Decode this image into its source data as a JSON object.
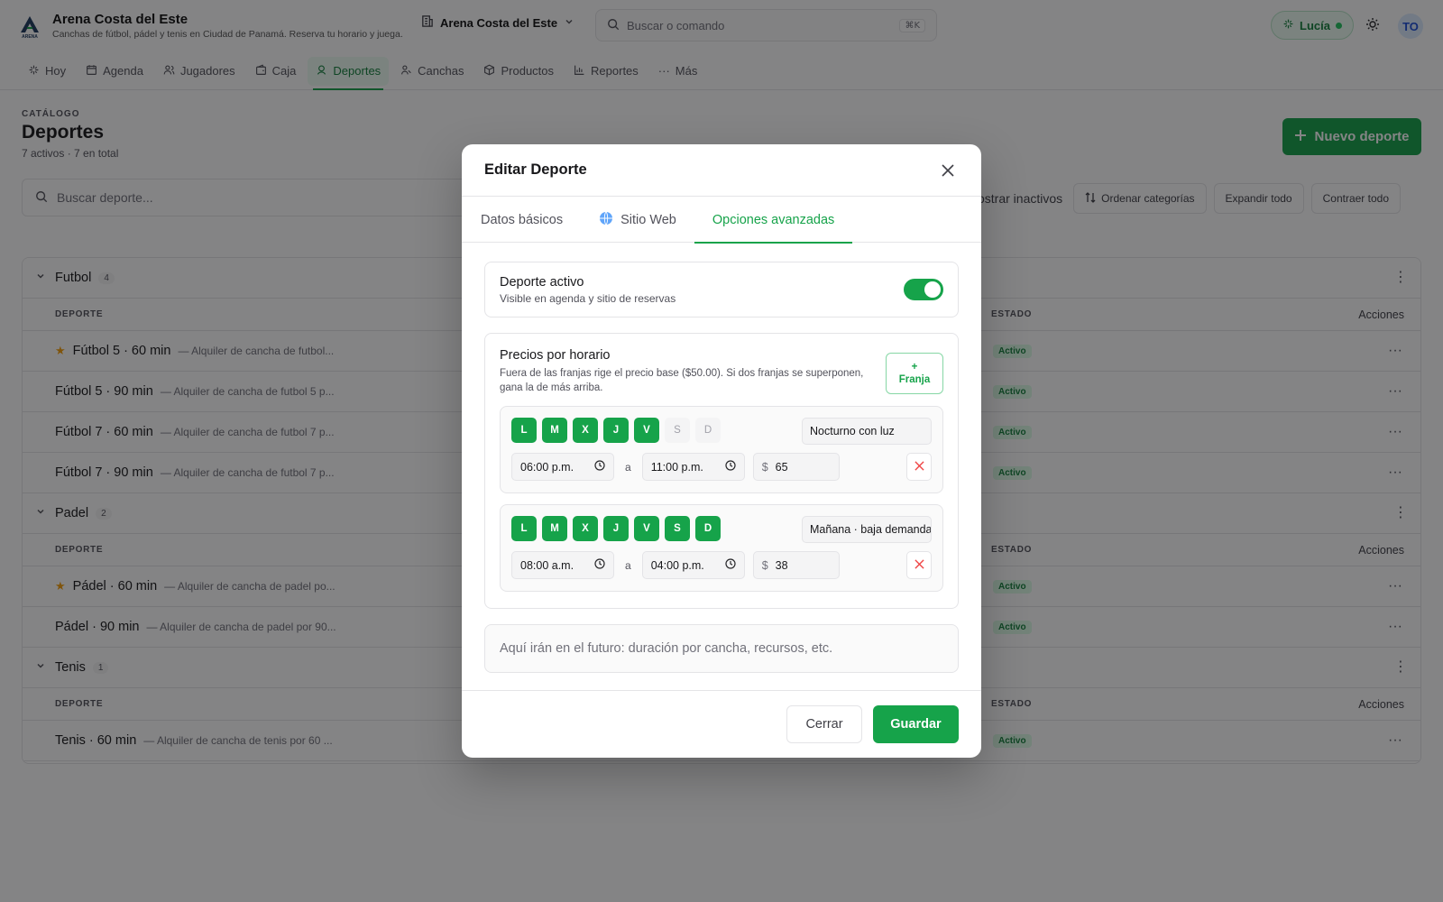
{
  "header": {
    "brand_name": "Arena Costa del Este",
    "brand_tagline": "Canchas de fútbol, pádel y tenis en Ciudad de Panamá. Reserva tu horario y juega.",
    "logo_text": "ARENA",
    "venue_selector": "Arena Costa del Este",
    "search_placeholder": "Buscar o comando",
    "search_shortcut": "⌘K",
    "user_name": "Lucía",
    "avatar_initials": "TO"
  },
  "nav": {
    "items": [
      {
        "label": "Hoy",
        "icon": "sparkle-icon"
      },
      {
        "label": "Agenda",
        "icon": "calendar-icon"
      },
      {
        "label": "Jugadores",
        "icon": "users-icon"
      },
      {
        "label": "Caja",
        "icon": "wallet-icon"
      },
      {
        "label": "Deportes",
        "icon": "sports-icon"
      },
      {
        "label": "Canchas",
        "icon": "court-icon"
      },
      {
        "label": "Productos",
        "icon": "box-icon"
      },
      {
        "label": "Reportes",
        "icon": "bar-chart-icon"
      },
      {
        "label": "Más",
        "icon": "more-icon"
      }
    ],
    "active": "Deportes"
  },
  "page": {
    "eyebrow": "CATÁLOGO",
    "title": "Deportes",
    "count": "7 activos · 7 en total",
    "new_button": "Nuevo deporte",
    "search_placeholder": "Buscar deporte...",
    "show_inactive": "ostrar inactivos",
    "sort_categories": "Ordenar categorías",
    "expand_all": "Expandir todo",
    "collapse_all": "Contraer todo"
  },
  "table": {
    "col_sport": "DEPORTE",
    "col_status": "ESTADO",
    "col_actions": "Acciones",
    "status_active": "Activo",
    "categories": [
      {
        "name": "Futbol",
        "count": "4",
        "sports": [
          {
            "name": "Fútbol 5 · 60 min",
            "desc": "— Alquiler de cancha de futbol...",
            "featured": true
          },
          {
            "name": "Fútbol 5 · 90 min",
            "desc": "— Alquiler de cancha de futbol 5 p...",
            "featured": false
          },
          {
            "name": "Fútbol 7 · 60 min",
            "desc": "— Alquiler de cancha de futbol 7 p...",
            "featured": false
          },
          {
            "name": "Fútbol 7 · 90 min",
            "desc": "— Alquiler de cancha de futbol 7 p...",
            "featured": false
          }
        ]
      },
      {
        "name": "Padel",
        "count": "2",
        "sports": [
          {
            "name": "Pádel · 60 min",
            "desc": "— Alquiler de cancha de padel po...",
            "featured": true
          },
          {
            "name": "Pádel · 90 min",
            "desc": "— Alquiler de cancha de padel por 90...",
            "featured": false
          }
        ]
      },
      {
        "name": "Tenis",
        "count": "1",
        "sports": [
          {
            "name": "Tenis · 60 min",
            "desc": "— Alquiler de cancha de tenis por 60 ...",
            "featured": false
          }
        ]
      }
    ]
  },
  "modal": {
    "title": "Editar Deporte",
    "tabs": [
      {
        "label": "Datos básicos",
        "icon": ""
      },
      {
        "label": "Sitio Web",
        "icon": "globe-icon"
      },
      {
        "label": "Opciones avanzadas",
        "icon": ""
      }
    ],
    "active_tab": "Opciones avanzadas",
    "active_toggle": {
      "title": "Deporte activo",
      "subtitle": "Visible en agenda y sitio de reservas",
      "on": true
    },
    "pricing": {
      "title": "Precios por horario",
      "description": "Fuera de las franjas rige el precio base ($50.00). Si dos franjas se superponen, gana la de más arriba.",
      "add_button_plus": "+",
      "add_button_label": "Franja",
      "to_label": "a",
      "currency": "$",
      "slots": [
        {
          "days": [
            {
              "label": "L",
              "on": true
            },
            {
              "label": "M",
              "on": true
            },
            {
              "label": "X",
              "on": true
            },
            {
              "label": "J",
              "on": true
            },
            {
              "label": "V",
              "on": true
            },
            {
              "label": "S",
              "on": false
            },
            {
              "label": "D",
              "on": false
            }
          ],
          "name": "Nocturno con luz",
          "start": "06:00 p.m.",
          "end": "11:00 p.m.",
          "price": "65"
        },
        {
          "days": [
            {
              "label": "L",
              "on": true
            },
            {
              "label": "M",
              "on": true
            },
            {
              "label": "X",
              "on": true
            },
            {
              "label": "J",
              "on": true
            },
            {
              "label": "V",
              "on": true
            },
            {
              "label": "S",
              "on": true
            },
            {
              "label": "D",
              "on": true
            }
          ],
          "name": "Mañana · baja demanda",
          "start": "08:00 a.m.",
          "end": "04:00 p.m.",
          "price": "38"
        }
      ]
    },
    "future_note": "Aquí irán en el futuro: duración por cancha, recursos, etc.",
    "close_button": "Cerrar",
    "save_button": "Guardar"
  },
  "colors": {
    "accent": "#16a34a",
    "accent_light": "#ecfdf3",
    "danger": "#ef4444",
    "star": "#f59e0b"
  }
}
